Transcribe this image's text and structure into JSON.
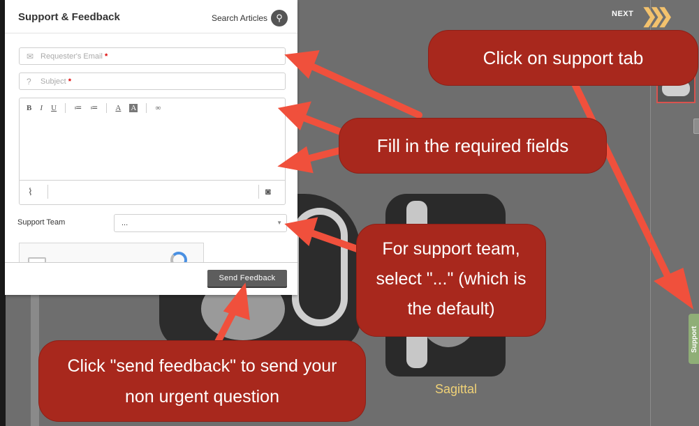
{
  "viewer": {
    "next_label": "NEXT",
    "support_tab_label": "Support",
    "view_label": "Sagittal"
  },
  "dialog": {
    "title": "Support & Feedback",
    "search_label": "Search Articles",
    "email_placeholder": "Requester's Email",
    "subject_placeholder": "Subject",
    "required_marker": "*",
    "toolbar": [
      "B",
      "I",
      "U",
      "≔",
      "≔",
      "A",
      "A",
      "∞"
    ],
    "support_team_label": "Support Team",
    "support_team_value": "...",
    "send_button": "Send Feedback"
  },
  "callouts": {
    "support_tab": "Click on support tab",
    "required_fields": "Fill in the required fields",
    "support_team": "For support team, select \"...\" (which is the default)",
    "send_feedback": "Click \"send feedback\" to send your non urgent question"
  },
  "colors": {
    "callout_bg": "#a8281d",
    "arrow": "#f0503c",
    "support_tab": "#8fae77",
    "chevrons": "#f3c26d"
  },
  "icons": [
    "search-icon",
    "envelope-icon",
    "question-circle-icon",
    "paperclip-icon",
    "camera-icon",
    "chevron-down-icon",
    "recaptcha-icon"
  ]
}
